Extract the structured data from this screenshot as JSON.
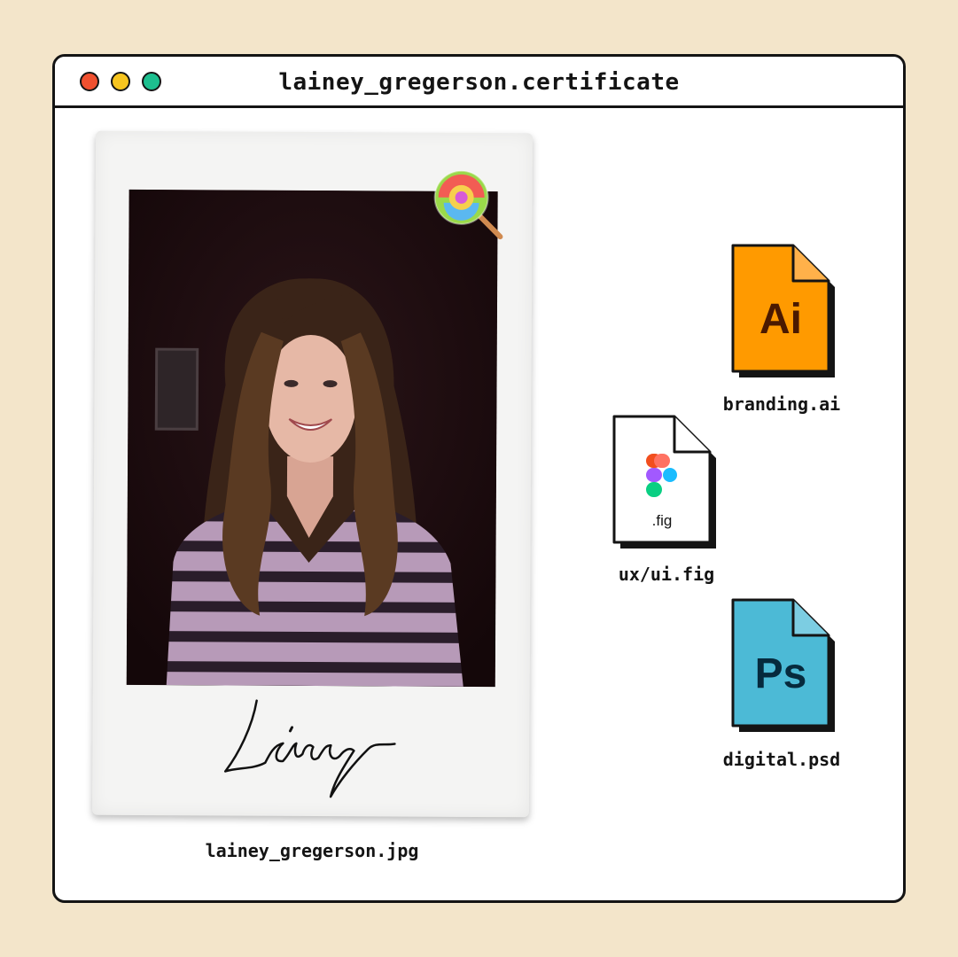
{
  "window": {
    "title": "lainey_gregerson.certificate",
    "controls": [
      "close-dot",
      "minimize-dot",
      "maximize-dot"
    ]
  },
  "photo": {
    "caption": "lainey_gregerson.jpg",
    "signature": "Lainey",
    "sticker": "lollipop-icon"
  },
  "files": [
    {
      "icon_label": "Ai",
      "name": "branding.ai",
      "color": "#ff9a00",
      "icon": "illustrator-file-icon"
    },
    {
      "icon_label": ".fig",
      "name": "ux/ui.fig",
      "color": "#ffffff",
      "icon": "figma-file-icon"
    },
    {
      "icon_label": "Ps",
      "name": "digital.psd",
      "color": "#4cbad6",
      "icon": "photoshop-file-icon"
    }
  ],
  "colors": {
    "background": "#f3e5ca",
    "outline": "#141414",
    "dot_red": "#f0502f",
    "dot_yellow": "#f7c51f",
    "dot_green": "#1dbf8f"
  }
}
